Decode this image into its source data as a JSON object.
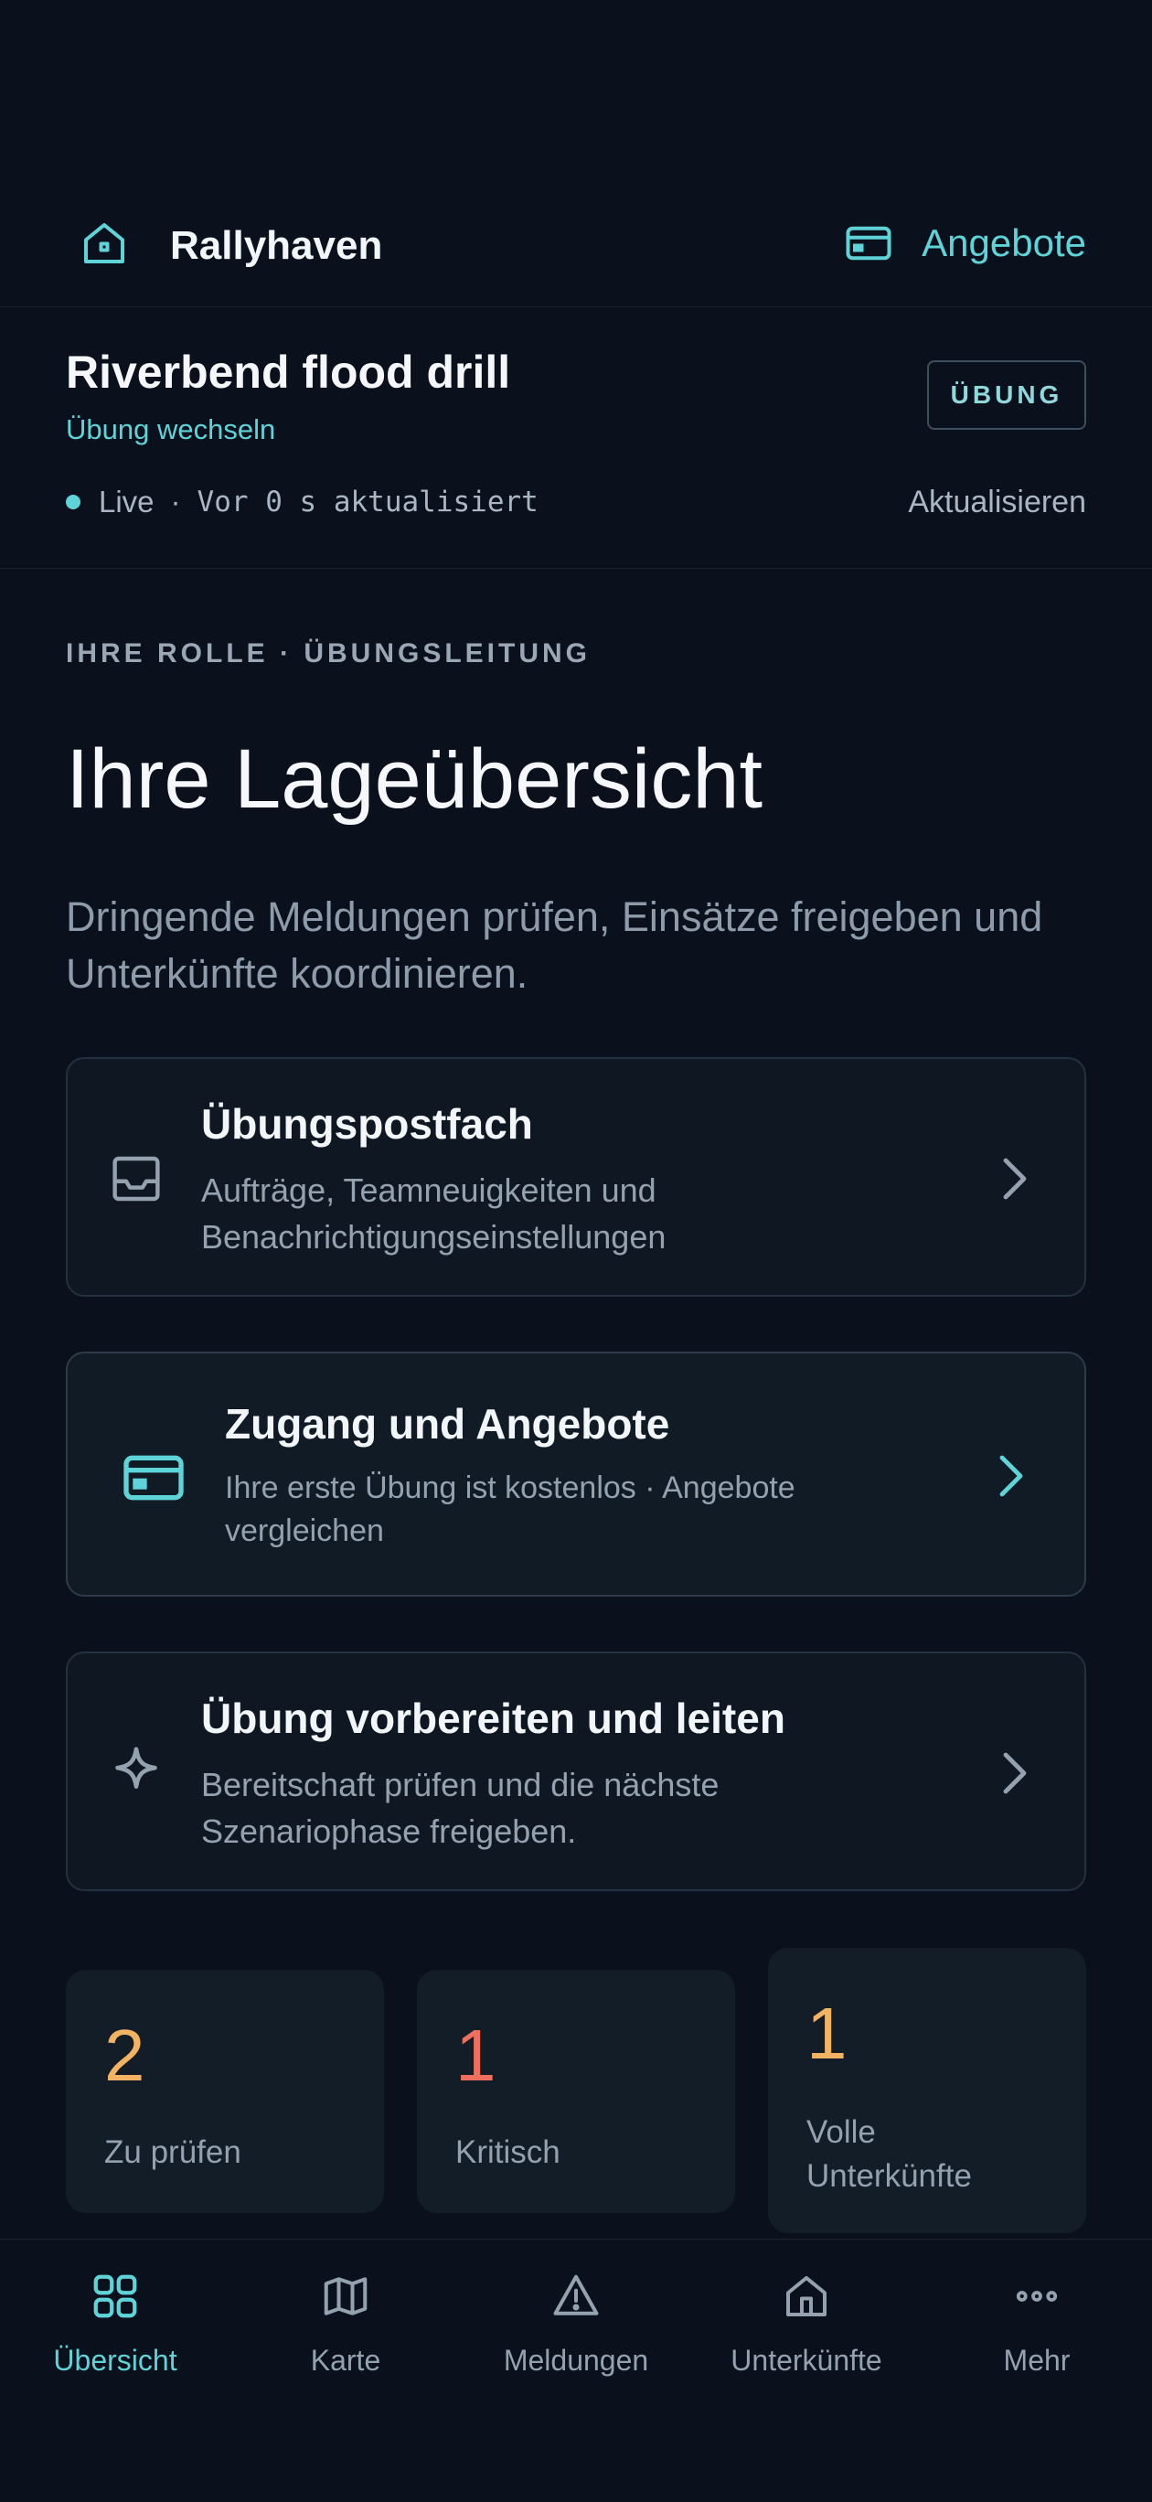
{
  "header": {
    "app_title": "Rallyhaven",
    "offers_label": "Angebote"
  },
  "drill": {
    "name": "Riverbend flood drill",
    "switch_label": "Übung wechseln",
    "badge": "ÜBUNG",
    "live_label": "Live",
    "separator": "·",
    "updated_label": "Vor 0 s aktualisiert",
    "refresh_label": "Aktualisieren"
  },
  "main": {
    "role": "IHRE ROLLE · ÜBUNGSLEITUNG",
    "headline": "Ihre Lageübersicht",
    "intro": "Dringende Meldungen prüfen, Einsätze freigeben und Unterkünfte koordinieren."
  },
  "cards": [
    {
      "title": "Übungspostfach",
      "subtitle": "Aufträge, Teamneuigkeiten und Benachrichtigungseinstellungen",
      "icon": "inbox-icon"
    },
    {
      "title": "Zugang und Angebote",
      "subtitle": "Ihre erste Übung ist kostenlos · Angebote vergleichen",
      "icon": "credit-card-icon"
    },
    {
      "title": "Übung vorbereiten und leiten",
      "subtitle": "Bereitschaft prüfen und die nächste Szenariophase freigeben.",
      "icon": "sparkle-icon"
    }
  ],
  "stats": [
    {
      "value": "2",
      "label": "Zu prüfen",
      "color": "#f2b463"
    },
    {
      "value": "1",
      "label": "Kritisch",
      "color": "#ef6f5e"
    },
    {
      "value": "1",
      "label": "Volle Unterkünfte",
      "color": "#f2b463"
    }
  ],
  "nav": [
    {
      "label": "Übersicht",
      "icon": "grid-icon",
      "active": true
    },
    {
      "label": "Karte",
      "icon": "map-icon"
    },
    {
      "label": "Meldungen",
      "icon": "warning-icon"
    },
    {
      "label": "Unterkünfte",
      "icon": "house-icon"
    },
    {
      "label": "Mehr",
      "icon": "more-icon"
    }
  ],
  "colors": {
    "accent": "#5fd4d8",
    "background": "#0a111c",
    "card": "#0f1822"
  }
}
